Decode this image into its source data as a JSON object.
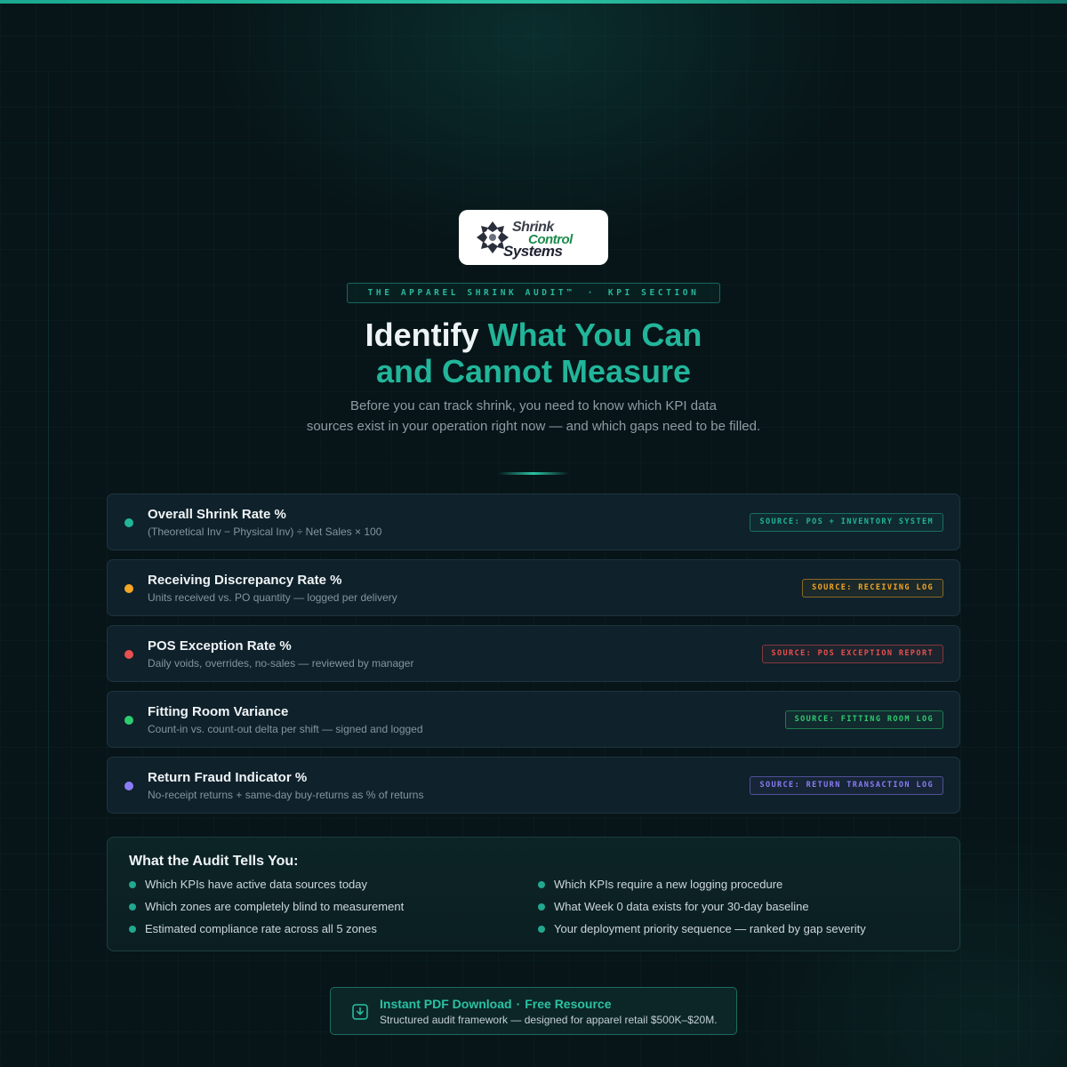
{
  "brand": {
    "logo_line1": "Shrink",
    "logo_line2": "Control",
    "logo_line3": "Systems",
    "logo_icon": "shrink-control-mark-icon"
  },
  "eyebrow": {
    "left": "THE APPAREL SHRINK AUDIT™",
    "separator": "·",
    "right": "KPI SECTION"
  },
  "headline": {
    "part1": "Identify ",
    "part2": "What You Can",
    "part3": "and Cannot Measure"
  },
  "subtitle": {
    "line1": "Before you can track shrink, you need to know which KPI data",
    "line2": "sources exist in your operation right now — and which gaps need to be filled."
  },
  "kpis": [
    {
      "title": "Overall Shrink Rate %",
      "description": "(Theoretical Inv − Physical Inv) ÷ Net Sales × 100",
      "source": "SOURCE: POS + INVENTORY SYSTEM",
      "color": "#22b59a"
    },
    {
      "title": "Receiving Discrepancy Rate %",
      "description": "Units received vs. PO quantity — logged per delivery",
      "source": "SOURCE: RECEIVING LOG",
      "color": "#f5a623"
    },
    {
      "title": "POS Exception Rate %",
      "description": "Daily voids, overrides, no-sales — reviewed by manager",
      "source": "SOURCE: POS EXCEPTION REPORT",
      "color": "#e8504f"
    },
    {
      "title": "Fitting Room Variance",
      "description": "Count-in vs. count-out delta per shift — signed and logged",
      "source": "SOURCE: FITTING ROOM LOG",
      "color": "#2ecc71"
    },
    {
      "title": "Return Fraud Indicator %",
      "description": "No-receipt returns + same-day buy-returns as % of returns",
      "source": "SOURCE: RETURN TRANSACTION LOG",
      "color": "#8b7cf6"
    }
  ],
  "audit": {
    "title": "What the Audit Tells You:",
    "left_items": [
      "Which KPIs have active data sources today",
      "Which zones are completely blind to measurement",
      "Estimated compliance rate across all 5 zones"
    ],
    "right_items": [
      "Which KPIs require a new logging procedure",
      "What Week 0 data exists for your 30-day baseline",
      "Your deployment priority sequence — ranked by gap severity"
    ]
  },
  "cta": {
    "title_left": "Instant PDF Download",
    "separator": "·",
    "title_right": "Free Resource",
    "subtitle": "Structured audit framework — designed for apparel retail $500K–$20M.",
    "icon": "download-icon"
  }
}
